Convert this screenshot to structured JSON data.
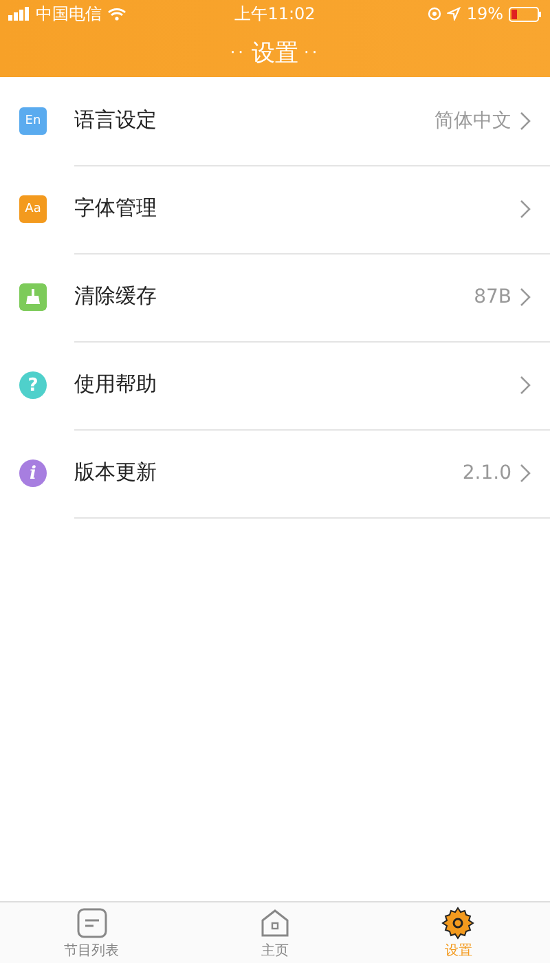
{
  "status_bar": {
    "carrier": "中国电信",
    "time": "上午11:02",
    "battery": "19%"
  },
  "header": {
    "title": "设置",
    "dots_left": "··",
    "dots_right": "··"
  },
  "settings": [
    {
      "kind": "lang",
      "label": "语言设定",
      "value": "简体中文",
      "icon_text": "En",
      "color": "#5aabef"
    },
    {
      "kind": "font",
      "label": "字体管理",
      "icon_text": "Aa",
      "color": "#f39a1e"
    },
    {
      "kind": "broom",
      "label": "清除缓存",
      "value": "87B",
      "color": "#7dcb5a"
    },
    {
      "kind": "help",
      "label": "使用帮助",
      "icon_text": "?",
      "color": "#4fd0cb"
    },
    {
      "kind": "info",
      "label": "版本更新",
      "value": "2.1.0",
      "icon_text": "i",
      "color": "#a77ee0"
    }
  ],
  "tab_bar": [
    {
      "kind": "list",
      "label": "节目列表",
      "selected": false
    },
    {
      "kind": "home",
      "label": "主页",
      "selected": false
    },
    {
      "kind": "gear",
      "label": "设置",
      "selected": true
    }
  ]
}
